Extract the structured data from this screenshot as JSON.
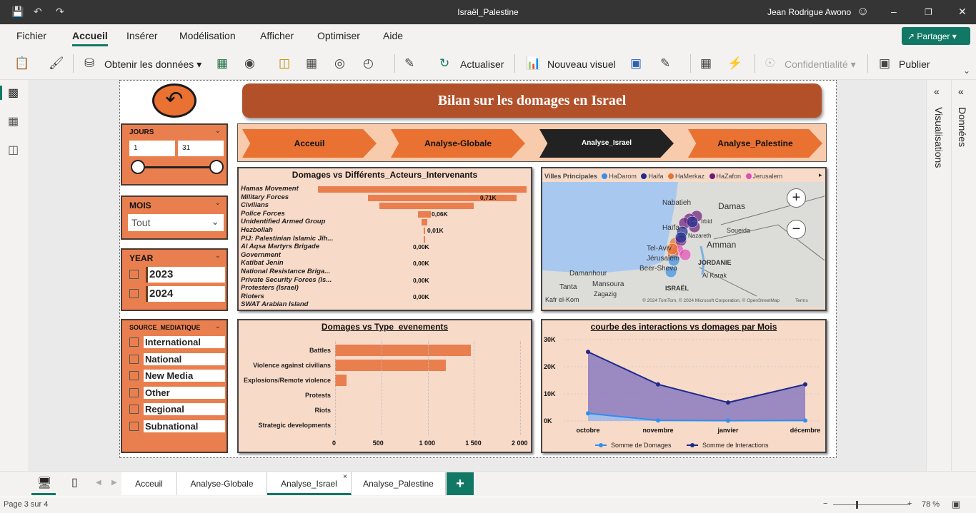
{
  "window": {
    "title": "Israël_Palestine",
    "user": "Jean Rodrigue Awono"
  },
  "menu": [
    "Fichier",
    "Accueil",
    "Insérer",
    "Modélisation",
    "Afficher",
    "Optimiser",
    "Aide"
  ],
  "share_label": "Partager",
  "ribbon": {
    "get_data": "Obtenir les données",
    "refresh": "Actualiser",
    "new_visual": "Nouveau visuel",
    "sensitivity": "Confidentialité",
    "publish": "Publier"
  },
  "right_panes": {
    "visualizations": "Visualisations",
    "data": "Données"
  },
  "report": {
    "banner": "Bilan sur les domages en Israel",
    "nav": [
      "Acceuil",
      "Analyse-Globale",
      "Analyse_Israel",
      "Analyse_Palestine"
    ],
    "active_nav": "Analyse_Israel",
    "slicers": {
      "jours": {
        "title": "JOURS",
        "min": "1",
        "max": "31"
      },
      "mois": {
        "title": "MOIS",
        "value": "Tout"
      },
      "year": {
        "title": "YEAR",
        "options": [
          "2023",
          "2024"
        ]
      },
      "source": {
        "title": "SOURCE_MEDIATIQUE",
        "options": [
          "International",
          "National",
          "New Media",
          "Other",
          "Regional",
          "Subnational"
        ]
      }
    },
    "map": {
      "legend_title": "Villes Principales",
      "legend": [
        {
          "name": "HaDarom",
          "color": "#3a8ee6"
        },
        {
          "name": "Haifa",
          "color": "#1f2d8f"
        },
        {
          "name": "HaMerkaz",
          "color": "#e97132"
        },
        {
          "name": "HaZafon",
          "color": "#6b1a7a"
        },
        {
          "name": "Jerusalem",
          "color": "#e24cb5"
        }
      ],
      "places": [
        "Nabatieh",
        "Damas",
        "Haïfa",
        "Soueida",
        "Tel-Aviv",
        "Amman",
        "Jérusalem",
        "Beer-Sheva",
        "JORDANIE",
        "Damanhour",
        "Al Karak",
        "Mansoura",
        "Tanta",
        "ISRAËL",
        "Zagazig",
        "Kafr el-Kom",
        "Irbid",
        "Nazareth"
      ],
      "attribution": "© 2024 TomTom, © 2024 Microsoft Corporation, © OpenStreetMap",
      "terms": "Terms"
    }
  },
  "chart_data": [
    {
      "type": "bar",
      "title": "Domages vs Différents_Acteurs_Intervenants",
      "categories": [
        "Hamas Movement",
        "Military Forces",
        "Civilians",
        "Police Forces",
        "Unidentified Armed Group",
        "Hezbollah",
        "PIJ: Palestinian Islamic Jih...",
        "Al Aqsa Martyrs Brigade",
        "Government",
        "Katibat Jenin",
        "National Resistance Briga...",
        "Private Security Forces (Is...",
        "Protesters (Israel)",
        "Rioters",
        "SWAT Arabian Island"
      ],
      "values": [
        1.0,
        0.71,
        0.45,
        0.06,
        0.03,
        0.01,
        0.005,
        0.0,
        0.0,
        0.0,
        0.0,
        0.0,
        0.0,
        0.0,
        0.0
      ],
      "data_labels": [
        "",
        "0,71K",
        "",
        "0,06K",
        "",
        "0,01K",
        "",
        "0,00K",
        "",
        "0,00K",
        "",
        "0,00K",
        "",
        "0,00K",
        ""
      ],
      "unit": "K"
    },
    {
      "type": "bar",
      "title": "Domages vs Type_evenements",
      "categories": [
        "Battles",
        "Violence against civilians",
        "Explosions/Remote violence",
        "Protests",
        "Riots",
        "Strategic developments"
      ],
      "values": [
        1470,
        1200,
        120,
        0,
        0,
        0
      ],
      "xlim": [
        0,
        2000
      ],
      "xticks": [
        "0",
        "500",
        "1 000",
        "1 500",
        "2 000"
      ]
    },
    {
      "type": "area",
      "title": "courbe des interactions vs domages par Mois",
      "categories": [
        "octobre",
        "novembre",
        "janvier",
        "décembre"
      ],
      "series": [
        {
          "name": "Somme de Domages",
          "values": [
            2800,
            200,
            100,
            150
          ],
          "color": "#2d8ff0"
        },
        {
          "name": "Somme de Interactions",
          "values": [
            25500,
            13500,
            6800,
            13500
          ],
          "color": "#1c2a8a"
        }
      ],
      "ylim": [
        0,
        30000
      ],
      "yticks": [
        "30K",
        "20K",
        "10K",
        "0K"
      ],
      "legend_position": "bottom"
    }
  ],
  "page_tabs": [
    "Acceuil",
    "Analyse-Globale",
    "Analyse_Israel",
    "Analyse_Palestine"
  ],
  "active_tab": "Analyse_Israel",
  "status": {
    "page": "Page 3 sur 4",
    "zoom": "78 %"
  }
}
